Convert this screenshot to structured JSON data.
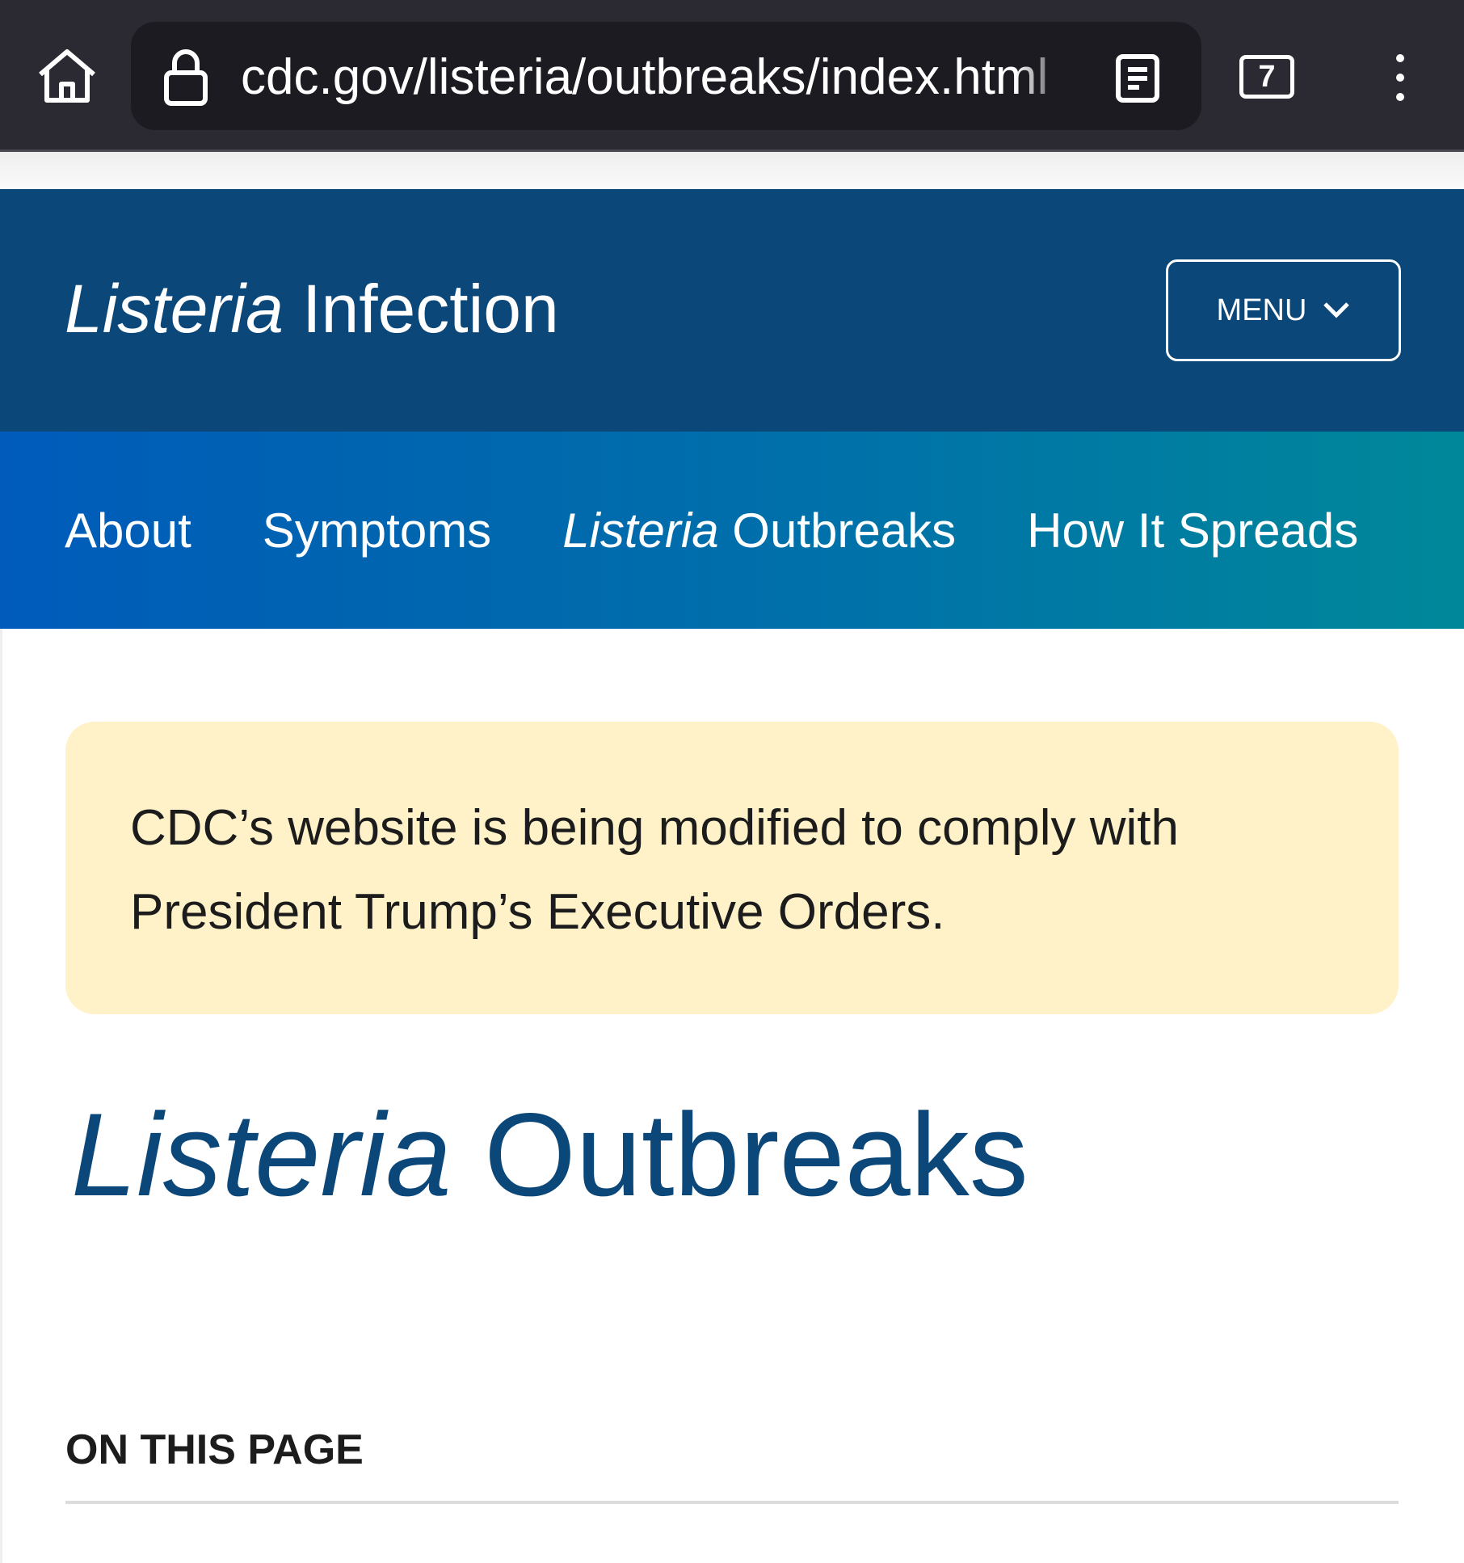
{
  "browser": {
    "url": "cdc.gov/listeria/outbreaks/index.html",
    "tab_count": "7",
    "icons": [
      "home-icon",
      "lock-icon",
      "reader-mode-icon",
      "tabs-icon",
      "more-vert-icon"
    ]
  },
  "header": {
    "title_italic": "Listeria",
    "title_rest": " Infection",
    "menu_label": "MENU"
  },
  "nav": {
    "items": [
      {
        "label": "About"
      },
      {
        "label": "Symptoms"
      },
      {
        "italic": "Listeria",
        "label": " Outbreaks"
      },
      {
        "label": "How It Spreads"
      }
    ]
  },
  "banner": {
    "text": "CDC’s website is being modified to comply with President Trump’s Executive Orders."
  },
  "main": {
    "title_italic": "Listeria",
    "title_rest": " Outbreaks",
    "on_this_page": "ON THIS PAGE"
  },
  "colors": {
    "header": "#0b4778",
    "banner": "#fff1c8",
    "nav_start": "#005bbb",
    "nav_end": "#00889a"
  }
}
